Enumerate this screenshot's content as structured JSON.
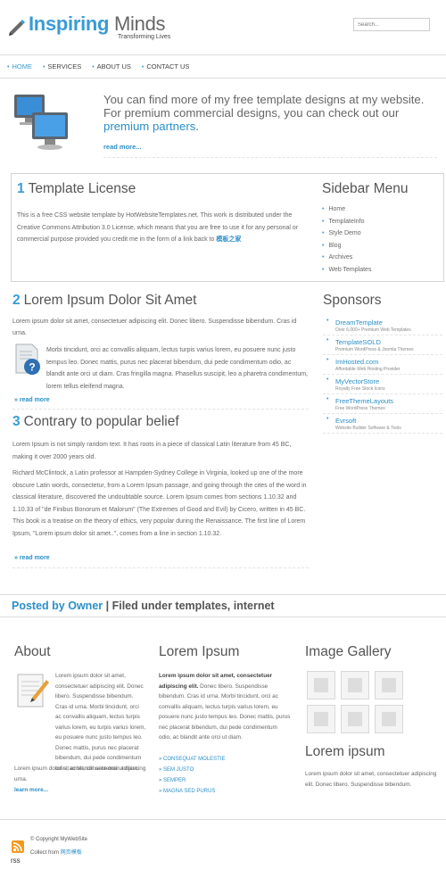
{
  "header": {
    "logo_primary": "Inspiring",
    "logo_secondary": "Minds",
    "tagline": "Transforming Lives",
    "search_placeholder": "Search..."
  },
  "nav": {
    "items": [
      {
        "label": "HOME",
        "active": true
      },
      {
        "label": "SERVICES",
        "active": false
      },
      {
        "label": "ABOUT US",
        "active": false
      },
      {
        "label": "CONTACT US",
        "active": false
      }
    ]
  },
  "intro": {
    "text_part1": "You can find more of my free template designs at my website. For premium commercial designs, you can check out our",
    "highlight": "premium partners",
    "text_part2": ".",
    "read_more": "read more..."
  },
  "license": {
    "number": "1",
    "title": "Template License",
    "text": "This is a free CSS website template by HotWebsiteTemplates.net. This work is distributed under the Creative Commons Attribution 3.0 License, which means that you are free to use it for any personal or commercial purpose provided you credit me in the form of a link back to",
    "link_text": "模板之家"
  },
  "sidebar_menu": {
    "title": "Sidebar Menu",
    "items": [
      "Home",
      "TemplateInfo",
      "Style Demo",
      "Blog",
      "Archives",
      "Web Templates"
    ]
  },
  "article2": {
    "number": "2",
    "title": "Lorem Ipsum Dolor Sit Amet",
    "p1": "Lorem ipsum dolor sit amet, consectetuer adipiscing elit. Donec libero. Suspendisse bibendum. Cras id urna.",
    "p2": "Morbi tincidunt, orci ac convallis aliquam, lectus turpis varius lorem, eu posuere nunc justo tempus leo. Donec mattis, purus nec placerat bibendum, dui pede condimentum odio, ac blandit ante orci ut diam. Cras fringilla magna. Phasellus suscipit, leo a pharetra condimentum, lorem tellus eleifend magna.",
    "read_more": "» read more"
  },
  "article3": {
    "number": "3",
    "title": "Contrary to popular belief",
    "p1": "Lorem Ipsum is not simply random text. It has roots in a piece of classical Latin literature from 45 BC, making it over 2000 years old.",
    "p2": "Richard McClintock, a Latin professor at Hampden-Sydney College in Virginia, looked up one of the more obscure Latin words, consectetur, from a Lorem Ipsum passage, and going through the cites of the word in classical literature, discovered the undoubtable source. Lorem Ipsum comes from sections 1.10.32 and 1.10.33 of \"de Finibus Bonorum et Malorum\" (The Extremes of Good and Evil) by Cicero, written in 45 BC. This book is a treatise on the theory of ethics, very popular during the Renaissance. The first line of Lorem Ipsum, \"Lorem ipsum dolor sit amet..\", comes from a line in section 1.10.32.",
    "read_more": "» read more"
  },
  "sponsors": {
    "title": "Sponsors",
    "items": [
      {
        "name": "DreamTemplate",
        "desc": "Over 6,000+ Premium Web Templates"
      },
      {
        "name": "TemplateSOLD",
        "desc": "Premium WordPress & Joomla Themes"
      },
      {
        "name": "ImHosted.com",
        "desc": "Affordable Web Hosting Provider"
      },
      {
        "name": "MyVectorStore",
        "desc": "Royalty Free Stock Icons"
      },
      {
        "name": "FreeThemeLayouts",
        "desc": "Free WordPress Themes"
      },
      {
        "name": "Evrsoft",
        "desc": "Website Builder Software & Tools"
      }
    ]
  },
  "posted": {
    "prefix": "Posted by",
    "owner": "Owner",
    "rest": "| Filed under templates, internet"
  },
  "about": {
    "title": "About",
    "p1": "Lorem ipsum dolor sit amet, consectetuer adipiscing elit. Donec libero. Suspendisse bibendum. Cras id urna. Morbi tincidunt, orci ac convallis aliquam, lectus turpis varius lorem, eu turpis varius lorem, eu posuere nunc justo tempus leo. Donec mattis, purus nec placerat bibendum, dui pede condimentum odio, ac blandit ante orci ut diam.",
    "p2": "Lorem ipsum dolor sit amet, consectetuer adipiscing urna.",
    "read_more": "learn more..."
  },
  "lorem": {
    "title": "Lorem Ipsum",
    "bold": "Lorem ipsum dolor sit amet, consectetuer adipiscing elit.",
    "text": "Donec libero. Suspendisse bibendum. Cras id urna. Morbi tincidunt, orci ac convallis aliquam, lectus turpis varius lorem, eu posuere nunc justo tempus leo. Donec mattis, purus nec placerat bibendum, dui pede condimentum odio, ac blandit ante orci ut diam.",
    "links": [
      "» CONSEQUAT MOLESTIE",
      "» SEM JUSTO",
      "» SEMPER",
      "» MAGNA SED PURUS"
    ]
  },
  "gallery": {
    "title": "Image Gallery",
    "title2": "Lorem ipsum",
    "text": "Lorem ipsum dolor sit amet, consectetuer adipiscing elit. Donec libero. Suspendisse bibendum."
  },
  "footer": {
    "copyright": "© Copyright MyWebSite",
    "collect_prefix": "Collect from",
    "collect_link": "网页模板",
    "rss": "rss"
  }
}
